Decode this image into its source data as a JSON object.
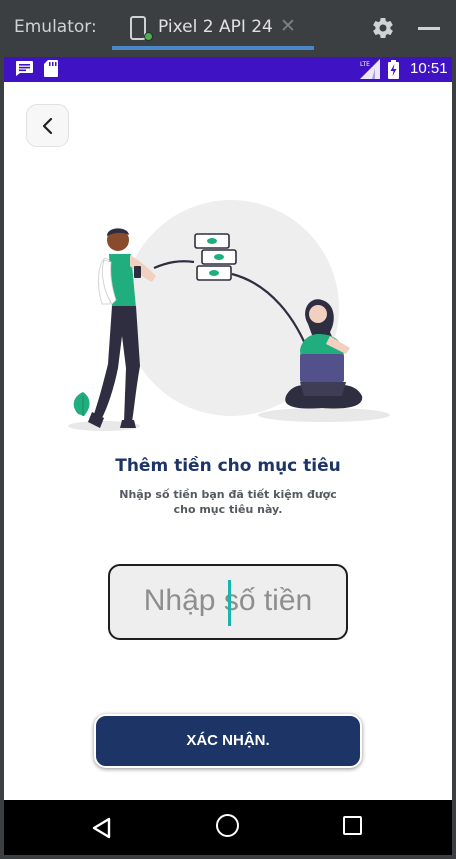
{
  "emulator": {
    "title": "Emulator:",
    "tab_label": "Pixel 2 API 24",
    "tab_close": "✕",
    "tab_icon": "phone-icon",
    "gear_icon": "gear-icon",
    "minimize_icon": "minimize-icon"
  },
  "status_bar": {
    "time": "10:51",
    "network": "LTE",
    "icons": [
      "message-icon",
      "sd-card-icon",
      "lte-signal-icon",
      "battery-charging-icon"
    ],
    "color": "#3f13c4"
  },
  "screen": {
    "back_icon": "chevron-left-icon",
    "illustration": "saving-money-illustration",
    "title": "Thêm tiền cho mục tiêu",
    "subtitle_line1": "Nhập số tiền bạn đã tiết kiệm được",
    "subtitle_line2": "cho  mục tiêu này.",
    "amount_placeholder": "Nhập số tiền",
    "confirm_label": "XÁC NHẬN.",
    "colors": {
      "primary": "#1c3466",
      "accent_green": "#21ae7e",
      "caret": "#19b5ac"
    }
  },
  "nav_bar": {
    "icons": [
      "nav-back-icon",
      "nav-home-icon",
      "nav-recents-icon"
    ]
  }
}
